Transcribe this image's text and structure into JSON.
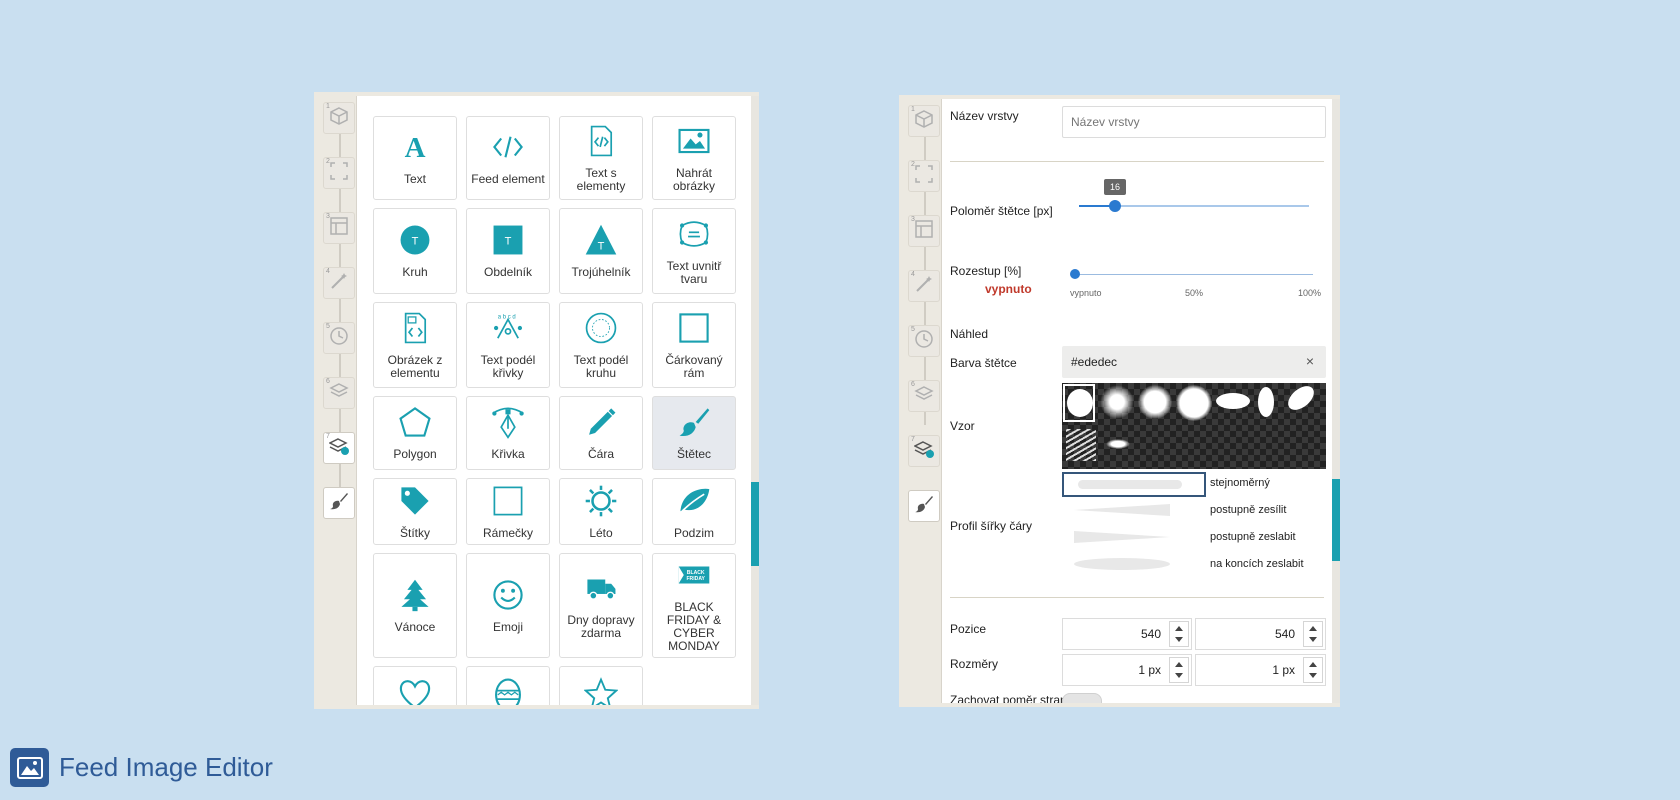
{
  "colors": {
    "accent": "#1aa0b0",
    "brand": "#2f5b97",
    "danger": "#c0392b",
    "slider": "#2a7ad0"
  },
  "left_panel": {
    "rail_steps": [
      {
        "num": "1",
        "icon": "cube-icon"
      },
      {
        "num": "2",
        "icon": "frame-icon"
      },
      {
        "num": "3",
        "icon": "layout-icon"
      },
      {
        "num": "4",
        "icon": "wand-icon"
      },
      {
        "num": "5",
        "icon": "clock-icon"
      },
      {
        "num": "6",
        "icon": "layers-icon"
      },
      {
        "num": "7",
        "icon": "layers-add-icon"
      },
      {
        "num": "",
        "icon": "brush-icon"
      }
    ],
    "tiles": [
      {
        "label": "Text",
        "icon": "text-icon"
      },
      {
        "label": "Feed element",
        "icon": "code-icon"
      },
      {
        "label": "Text s elementy",
        "icon": "file-code-icon"
      },
      {
        "label": "Nahrát obrázky",
        "icon": "image-icon"
      },
      {
        "label": "Kruh",
        "icon": "circle-icon"
      },
      {
        "label": "Obdelník",
        "icon": "rectangle-icon"
      },
      {
        "label": "Trojúhelník",
        "icon": "triangle-icon"
      },
      {
        "label": "Text uvnitř tvaru",
        "icon": "text-in-shape-icon"
      },
      {
        "label": "Obrázek z elementu",
        "icon": "file-image-icon"
      },
      {
        "label": "Text podél křivky",
        "icon": "curve-text-icon"
      },
      {
        "label": "Text podél kruhu",
        "icon": "circle-text-icon"
      },
      {
        "label": "Čárkovaný rám",
        "icon": "dashed-frame-icon"
      },
      {
        "label": "Polygon",
        "icon": "polygon-icon"
      },
      {
        "label": "Křivka",
        "icon": "pen-curve-icon"
      },
      {
        "label": "Čára",
        "icon": "pencil-icon"
      },
      {
        "label": "Štětec",
        "icon": "brush-icon"
      },
      {
        "label": "Štítky",
        "icon": "tag-icon"
      },
      {
        "label": "Rámečky",
        "icon": "square-frame-icon"
      },
      {
        "label": "Léto",
        "icon": "sun-icon"
      },
      {
        "label": "Podzim",
        "icon": "leaf-icon"
      },
      {
        "label": "Vánoce",
        "icon": "tree-icon"
      },
      {
        "label": "Emoji",
        "icon": "smiley-icon"
      },
      {
        "label": "Dny dopravy zdarma",
        "icon": "truck-icon"
      },
      {
        "label": "BLACK FRIDAY & CYBER MONDAY",
        "icon": "black-friday-icon"
      },
      {
        "label": "",
        "icon": "heart-icon"
      },
      {
        "label": "",
        "icon": "easter-egg-icon"
      },
      {
        "label": "",
        "icon": "star-icon"
      }
    ]
  },
  "right_panel": {
    "layer_name_label": "Název vrstvy",
    "layer_name_placeholder": "Název vrstvy",
    "brush_radius_label": "Poloměr štětce [px]",
    "brush_radius_value": "16",
    "spacing_label": "Rozestup [%]",
    "spacing_state": "vypnuto",
    "spacing_ticks": [
      "vypnuto",
      "50%",
      "100%"
    ],
    "preview_label": "Náhled",
    "brush_color_label": "Barva štětce",
    "brush_color_value": "#ededec",
    "clear_symbol": "×",
    "pattern_label": "Vzor",
    "width_profile_label": "Profil šířky čáry",
    "width_profiles": [
      "stejnoměrný",
      "postupně zesílit",
      "postupně zeslabit",
      "na koncích zeslabit"
    ],
    "position_label": "Pozice",
    "position_x": "540",
    "position_y": "540",
    "size_label": "Rozměry",
    "size_w": "1 px",
    "size_h": "1 px",
    "keep_ratio_label": "Zachovat poměr stran"
  },
  "brand": {
    "title": "Feed Image Editor",
    "icon": "image-icon"
  }
}
